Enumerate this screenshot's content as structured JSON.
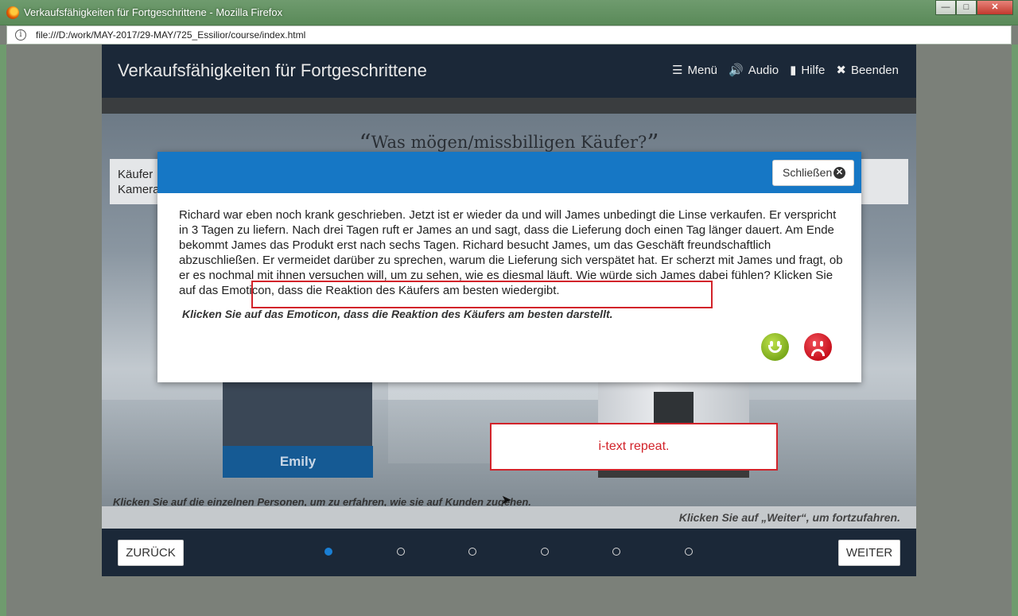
{
  "browser": {
    "window_title": "Verkaufsfähigkeiten für Fortgeschrittene - Mozilla Firefox",
    "url": "file:///D:/work/MAY-2017/29-MAY/725_Essilior/course/index.html",
    "minimize": "—",
    "maximize": "□",
    "close": "✕"
  },
  "course": {
    "title": "Verkaufsfähigkeiten für Fortgeschrittene",
    "menu": [
      {
        "label": "Menü",
        "icon": "list-icon",
        "glyph": "☰"
      },
      {
        "label": "Audio",
        "icon": "speaker-icon",
        "glyph": "🔊"
      },
      {
        "label": "Hilfe",
        "icon": "document-icon",
        "glyph": "▮"
      },
      {
        "label": "Beenden",
        "icon": "close-icon",
        "glyph": "✖"
      }
    ],
    "scene_heading": "Was mögen/missbilligen Käufer?",
    "scene_text": "Käufer\nKamera",
    "person_name": "Emily",
    "itext": "i-text repeat.",
    "instruction": "Klicken Sie auf die einzelnen Personen, um zu erfahren, wie sie auf Kunden zugehen.",
    "weiter_hint": "Klicken Sie auf „Weiter“, um fortzufahren.",
    "back_label": "ZURÜCK",
    "next_label": "WEITER",
    "pages_total": 6,
    "current_page": 1
  },
  "modal": {
    "close_label": "Schließen",
    "body": "Richard war eben noch krank geschrieben. Jetzt ist er wieder da und will James unbedingt die Linse verkaufen. Er verspricht in 3 Tagen zu liefern. Nach drei Tagen ruft er James an und sagt, dass die Lieferung doch einen Tag länger dauert. Am Ende bekommt James das Produkt erst nach sechs Tagen. Richard besucht James, um das Geschäft freundschaftlich abzuschließen. Er vermeidet darüber zu sprechen, warum die Lieferung sich verspätet hat. Er scherzt mit James und fragt, ob er es nochmal mit ihnen versuchen will, um zu sehen, wie es diesmal läuft. Wie würde sich James dabei fühlen? Klicken Sie auf das Emoticon, dass die Reaktion des Käufers am besten wiedergibt.",
    "sub_instruction": "Klicken Sie auf das Emoticon, dass die Reaktion des Käufers am besten darstellt.",
    "colors": {
      "header": "#1677c5",
      "happy": "#7aa91a",
      "sad": "#c8101c",
      "highlight": "#d2232a"
    }
  }
}
